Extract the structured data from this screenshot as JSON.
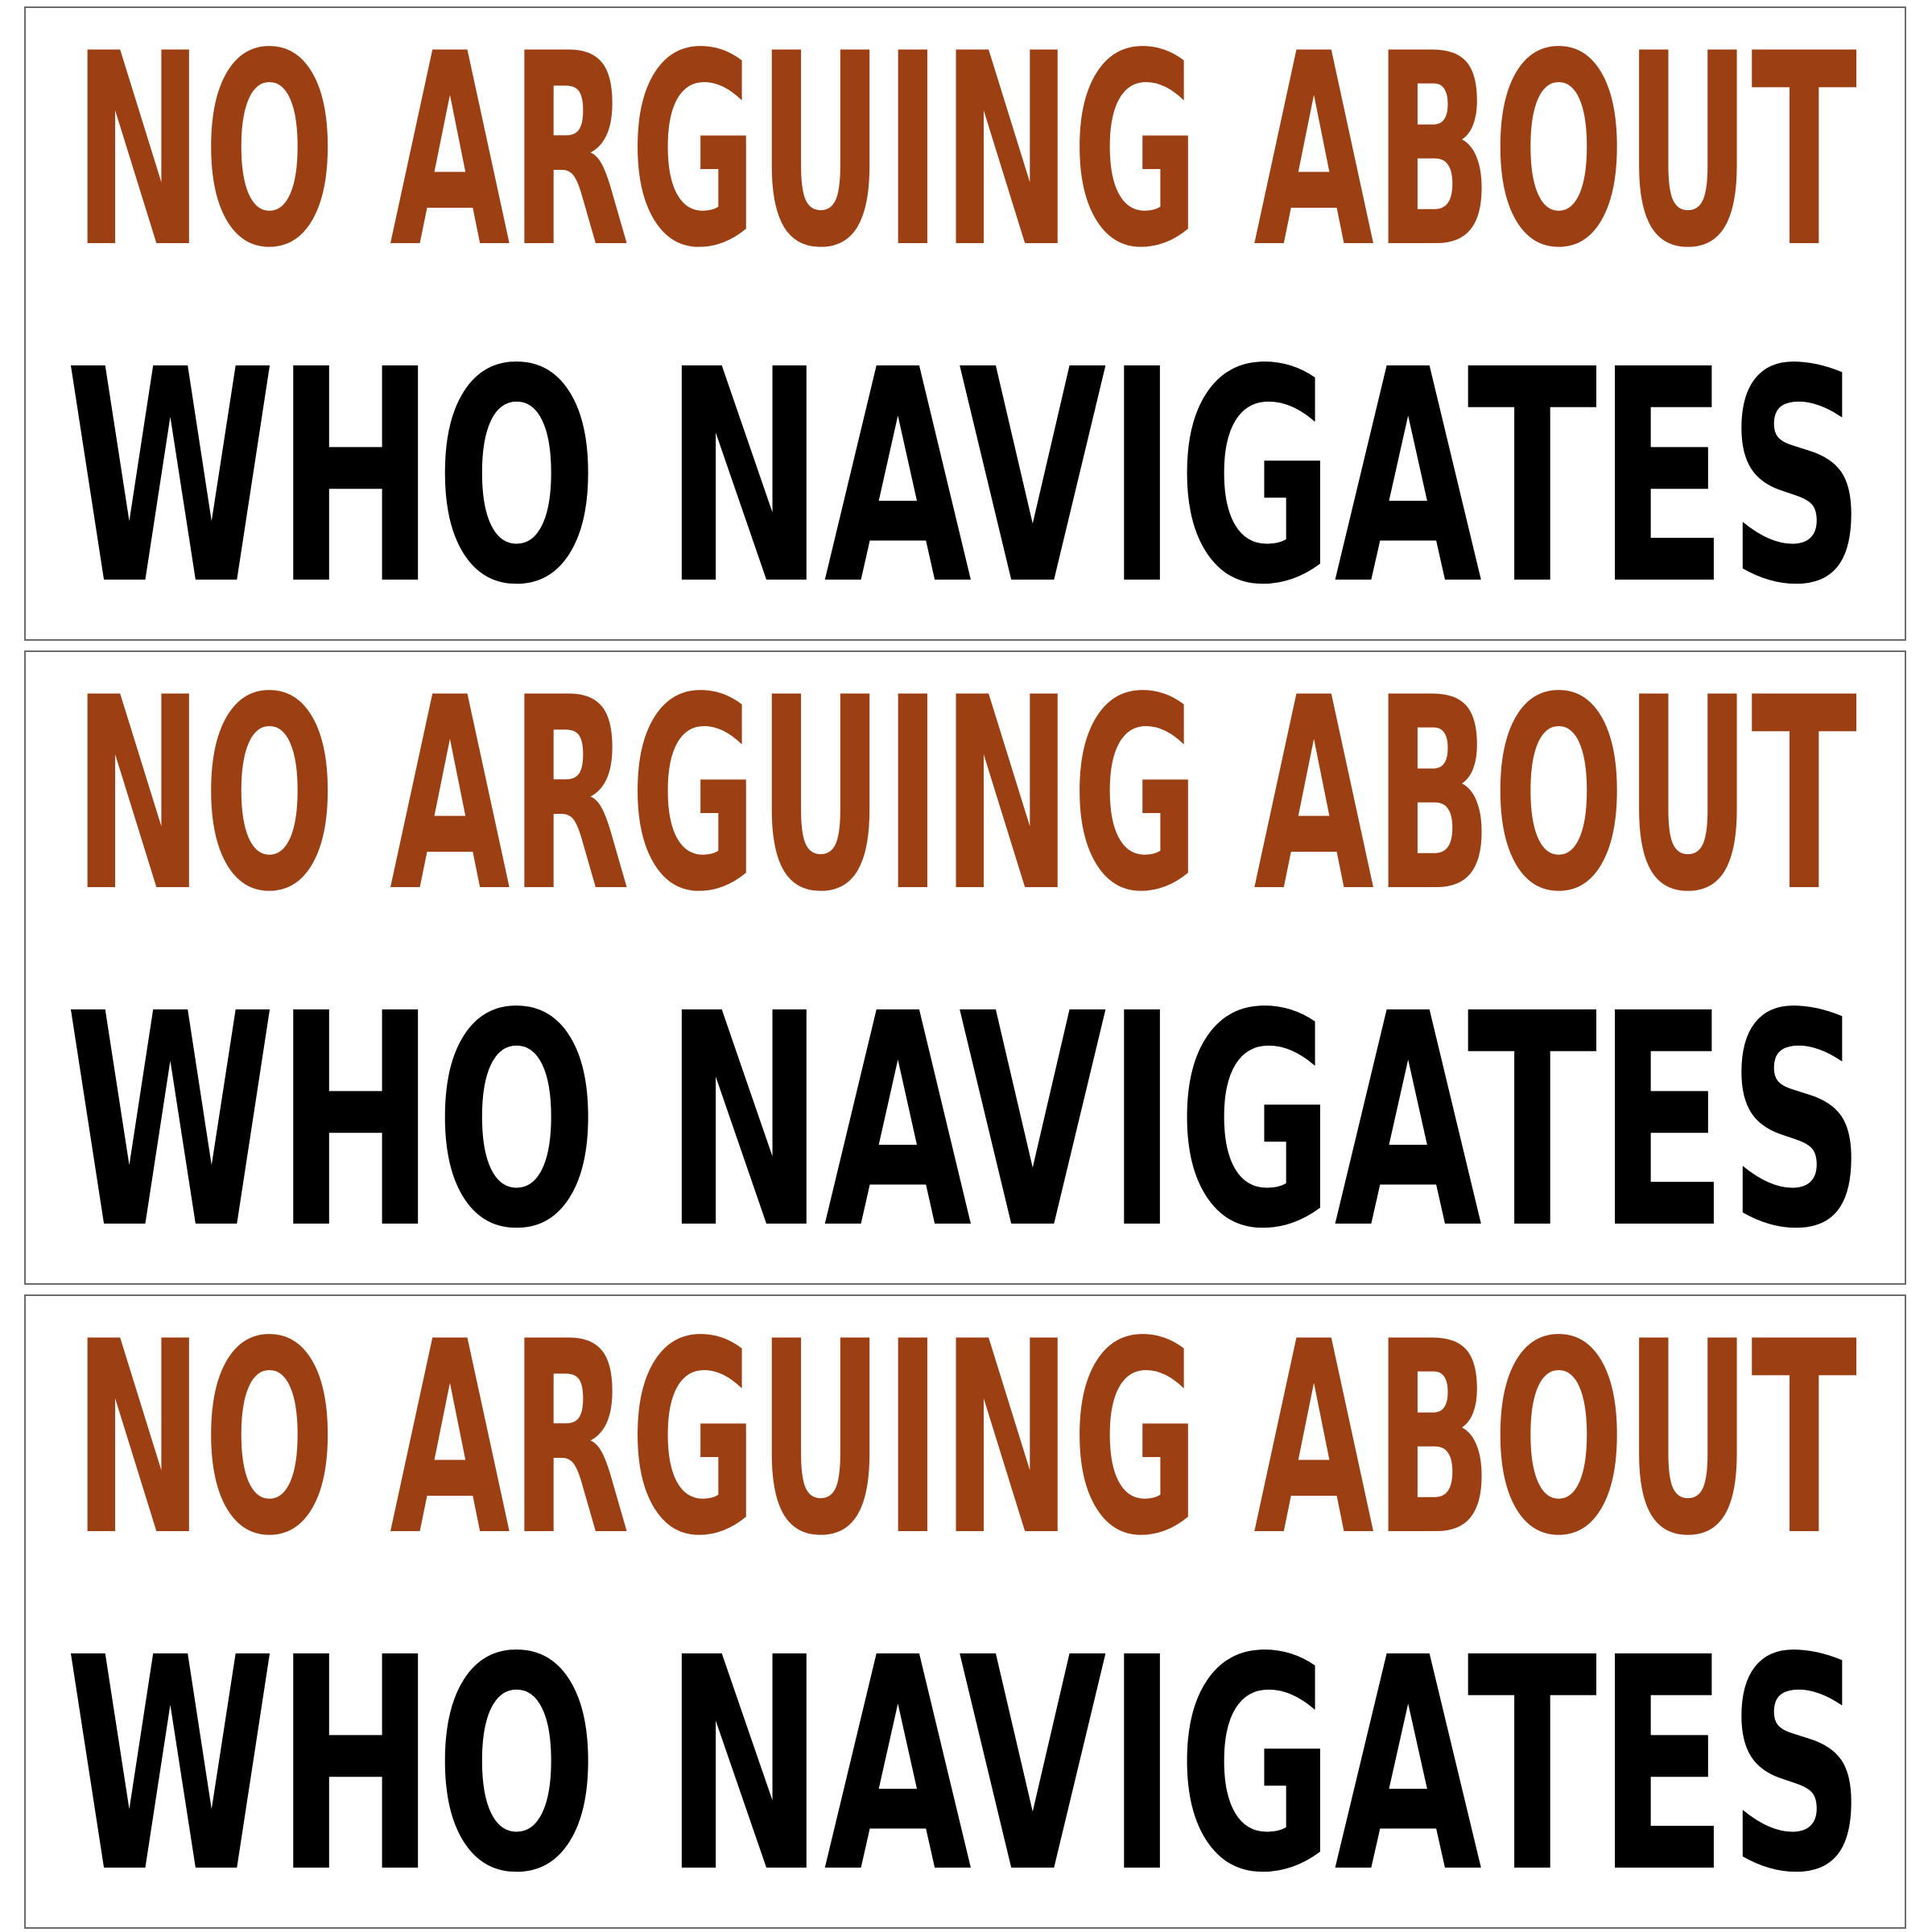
{
  "colors": {
    "rust": "#9c3f12",
    "black": "#000000",
    "border": "#6b6b6b"
  },
  "stickers": [
    {
      "line1": "NO ARGUING ABOUT",
      "line2": "WHO NAVIGATES"
    },
    {
      "line1": "NO ARGUING ABOUT",
      "line2": "WHO NAVIGATES"
    },
    {
      "line1": "NO ARGUING ABOUT",
      "line2": "WHO NAVIGATES"
    }
  ]
}
